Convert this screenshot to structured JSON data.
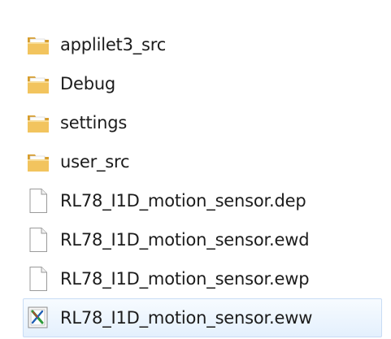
{
  "file_list": {
    "items": [
      {
        "name": "applilet3_src",
        "type": "folder",
        "icon": "folder-icon"
      },
      {
        "name": "Debug",
        "type": "folder",
        "icon": "folder-icon"
      },
      {
        "name": "settings",
        "type": "folder",
        "icon": "folder-icon"
      },
      {
        "name": "user_src",
        "type": "folder",
        "icon": "folder-icon"
      },
      {
        "name": "RL78_I1D_motion_sensor.dep",
        "type": "file",
        "icon": "document-icon"
      },
      {
        "name": "RL78_I1D_motion_sensor.ewd",
        "type": "file",
        "icon": "document-icon"
      },
      {
        "name": "RL78_I1D_motion_sensor.ewp",
        "type": "file",
        "icon": "document-icon"
      },
      {
        "name": "RL78_I1D_motion_sensor.eww",
        "type": "file",
        "icon": "workspace-file-icon",
        "selected": true
      }
    ]
  },
  "colors": {
    "folder_front": "#f2c45e",
    "folder_back": "#d89e2c",
    "selection_bg": "#e4f0fd",
    "selection_border": "#c8dcf5",
    "text": "#1c1c1c"
  }
}
